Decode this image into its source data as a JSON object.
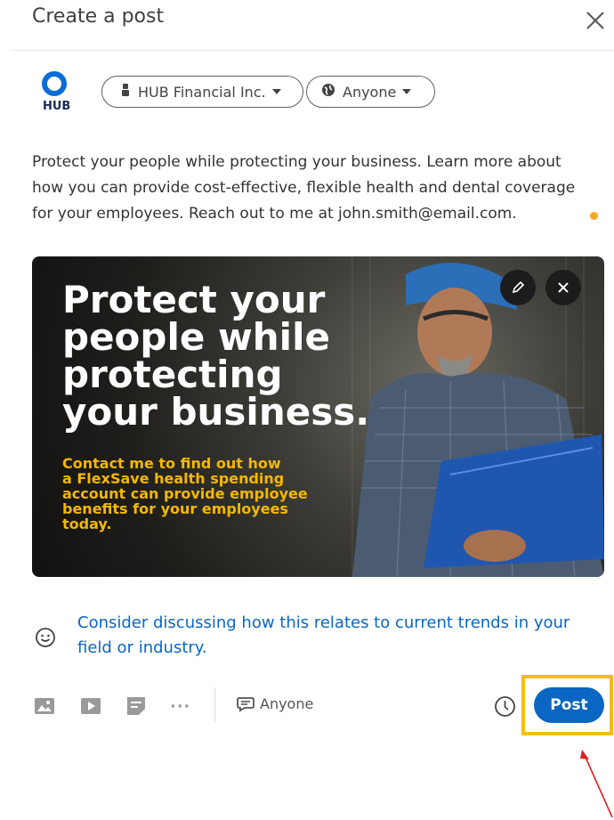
{
  "dialog": {
    "title": "Create a post",
    "close_icon": "close-icon"
  },
  "author": {
    "logo_text": "HUB",
    "company_selector": "HUB Financial Inc.",
    "audience_selector": "Anyone"
  },
  "post": {
    "text_lines": [
      "Protect your people while protecting your business. Learn more about",
      "how you can provide cost-effective, flexible health and dental coverage",
      "for your employees. Reach out to me at john.smith@email.com."
    ]
  },
  "media": {
    "headline_lines": [
      "Protect your",
      "people while",
      "protecting",
      "your business."
    ],
    "subline_lines": [
      "Contact me to find out how",
      "a FlexSave health spending",
      "account can provide employee",
      "benefits for your employees",
      "today."
    ],
    "edit_icon": "pencil-icon",
    "remove_icon": "close-icon"
  },
  "suggestion": {
    "lines": [
      "Consider discussing how this relates to current trends in your",
      "field or industry."
    ],
    "icon": "smiley-icon"
  },
  "toolbar": {
    "icons": [
      "image-icon",
      "video-icon",
      "document-icon",
      "more-icon"
    ],
    "comment_setting": "Anyone",
    "schedule_icon": "clock-icon",
    "post_label": "Post"
  },
  "colors": {
    "accent": "#0a66c2",
    "highlight": "#f5be0b",
    "annotation_arrow": "#e02020",
    "media_yellow": "#f5b800"
  }
}
